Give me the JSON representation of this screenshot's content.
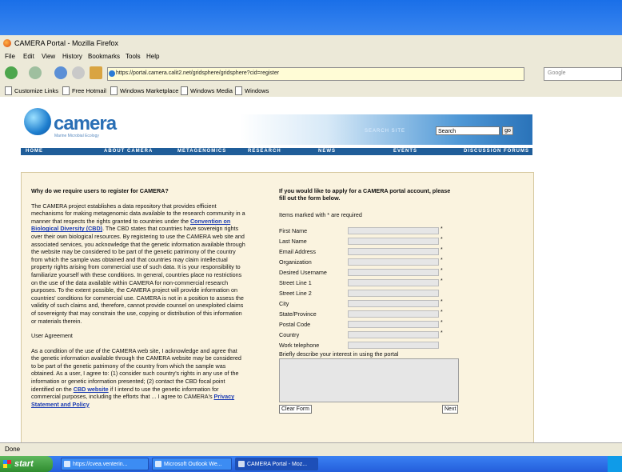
{
  "window": {
    "title": "CAMERA Portal - Mozilla Firefox"
  },
  "menu": [
    "File",
    "Edit",
    "View",
    "History",
    "Bookmarks",
    "Tools",
    "Help"
  ],
  "nav": {
    "url": "https://portal.camera.calit2.net/gridsphere/gridsphere?cid=register",
    "search_placeholder": "Google"
  },
  "bookmarks": [
    "Customize Links",
    "Free Hotmail",
    "Windows Marketplace",
    "Windows Media",
    "Windows"
  ],
  "site": {
    "logo": "camera",
    "logo_sub": "Marine Microbial Ecology",
    "search_label": "SEARCH SITE",
    "search_value": "Search",
    "go": "go",
    "nav": [
      "HOME",
      "ABOUT CAMERA",
      "METAGENOMICS",
      "RESEARCH",
      "NEWS",
      "EVENTS",
      "DISCUSSION FORUMS"
    ]
  },
  "left": {
    "heading": "Why do we require users to register for CAMERA?",
    "p1_a": "The CAMERA project establishes a data repository that provides efficient mechanisms for making metagenomic data available to the research community in a manner that respects the rights granted to countries under the ",
    "p1_link": "Convention on Biological Diversity (CBD)",
    "p1_b": ". The CBD states that countries have sovereign rights over their own biological resources. By registering to use the CAMERA web site and associated services, you acknowledge that the genetic information available through the website may be considered to be part of the genetic patrimony of the country from which the sample was obtained and that countries may claim intellectual property rights arising from commercial use of such data. It is your responsibility to familiarize yourself with these conditions. In general, countries place no restrictions on the use of the data available within CAMERA for non-commercial research purposes. To the extent possible, the CAMERA project will provide information on countries' conditions for commercial use. CAMERA is not in a position to assess the validity of such claims and, therefore, cannot provide counsel on unexploited claims of sovereignty that may constrain the use, copying or distribution of this information or materials therein.",
    "agreement_heading": "User Agreement",
    "p2_a": "As a condition of the use of the CAMERA web site, I acknowledge and agree that the genetic information available through the CAMERA website may be considered to be part of the genetic patrimony of the country from which the sample was obtained. As a user, I agree to: (1) consider such country's rights in any use of the information or genetic information presented; (2) contact the CBD focal point identified on the ",
    "p2_link": "CBD website",
    "p2_b": " if I intend to use the genetic information for commercial purposes, including the efforts that ... I agree to CAMERA's ",
    "p2_link2": "Privacy Statement and Policy"
  },
  "form": {
    "intro": "If you would like to apply for a CAMERA portal account, please fill out the form below.",
    "required_note": "Items marked with * are required",
    "fields": [
      {
        "label": "First Name",
        "req": "*"
      },
      {
        "label": "Last Name",
        "req": "*"
      },
      {
        "label": "Email Address",
        "req": "*"
      },
      {
        "label": "Organization",
        "req": "*"
      },
      {
        "label": "Desired Username",
        "req": "*"
      },
      {
        "label": "Street Line 1",
        "req": "*"
      },
      {
        "label": "Street Line 2",
        "req": ""
      },
      {
        "label": "City",
        "req": "*"
      },
      {
        "label": "State/Province",
        "req": "*"
      },
      {
        "label": "Postal Code",
        "req": "*"
      },
      {
        "label": "Country",
        "req": "*"
      },
      {
        "label": "Work telephone",
        "req": ""
      }
    ],
    "interest_label": "Briefly describe your interest in using the portal",
    "clear_button": "Clear Form",
    "next_button": "Next"
  },
  "status": "Done",
  "taskbar": {
    "start": "start",
    "items": [
      "https://cvea.venterin...",
      "Microsoft Outlook We...",
      "CAMERA Portal - Moz..."
    ]
  }
}
